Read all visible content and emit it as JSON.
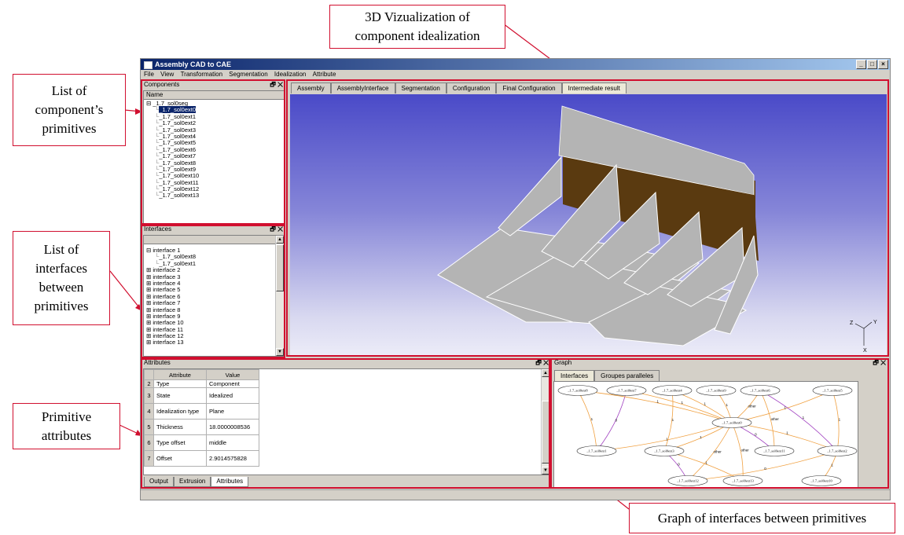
{
  "callouts": {
    "viz": "3D Vizualization of\ncomponent idealization",
    "components": "List of\ncomponent’s\nprimitives",
    "interfaces": "List of\ninterfaces\nbetween\nprimitives",
    "attributes": "Primitive\nattributes",
    "graph": "Graph of interfaces between primitives"
  },
  "window": {
    "title": "Assembly CAD to CAE",
    "min": "_",
    "max": "□",
    "close": "×"
  },
  "menu": [
    "File",
    "View",
    "Transformation",
    "Segmentation",
    "Idealization",
    "Attribute"
  ],
  "components_panel": {
    "title": "Components",
    "column": "Name",
    "root": "_1.7_sol0seg",
    "items": [
      "_1.7_sol0ext0",
      "_1.7_sol0ext1",
      "_1.7_sol0ext2",
      "_1.7_sol0ext3",
      "_1.7_sol0ext4",
      "_1.7_sol0ext5",
      "_1.7_sol0ext6",
      "_1.7_sol0ext7",
      "_1.7_sol0ext8",
      "_1.7_sol0ext9",
      "_1.7_sol0ext10",
      "_1.7_sol0ext11",
      "_1.7_sol0ext12",
      "_1.7_sol0ext13"
    ]
  },
  "interfaces_panel": {
    "title": "Interfaces",
    "expanded": "interface 1",
    "children": [
      "_1.7_sol0ext8",
      "_1.7_sol0ext1"
    ],
    "collapsed": [
      "interface 2",
      "interface 3",
      "interface 4",
      "interface 5",
      "interface 6",
      "interface 7",
      "interface 8",
      "interface 9",
      "interface 10",
      "interface 11",
      "interface 12",
      "interface 13"
    ]
  },
  "view_tabs": [
    "Assembly",
    "AssemblyInterface",
    "Segmentation",
    "Configuration",
    "Final Configuration",
    "Intermediate result"
  ],
  "axes": {
    "y": "Y",
    "z": "Z",
    "x": "X"
  },
  "attributes_panel": {
    "title": "Attributes",
    "col_attribute": "Attribute",
    "col_value": "Value",
    "rows": [
      {
        "n": "2",
        "attr": "Type",
        "val": "Component"
      },
      {
        "n": "3",
        "attr": "State",
        "val": "Idealized"
      },
      {
        "n": "4",
        "attr": "Idealization type",
        "val": "Plane"
      },
      {
        "n": "5",
        "attr": "Thickness",
        "val": "18.0000008536"
      },
      {
        "n": "6",
        "attr": "Type offset",
        "val": "middle"
      },
      {
        "n": "7",
        "attr": "Offset",
        "val": "2.9014575828"
      }
    ],
    "tabs": [
      "Output",
      "Extrusion",
      "Attributes"
    ]
  },
  "graph_panel": {
    "title": "Graph",
    "tabs": [
      "Interfaces",
      "Groupes paralleles"
    ],
    "nodes": {
      "n8": "_1.7_sol0ext8",
      "n7": "_1.7_sol0ext7",
      "n4": "_1.7_sol0ext4",
      "n9": "_1.7_sol0ext9",
      "n6": "_1.7_sol0ext6",
      "n5": "_1.7_sol0ext5",
      "n0": "_1.7_sol0ext0",
      "n1": "_1.7_sol0ext1",
      "n3": "_1.7_sol0ext3",
      "n11": "_1.7_sol0ext11",
      "n2": "_1.7_sol0ext2",
      "n12": "_1.7_sol0ext12",
      "n13": "_1.7_sol0ext13",
      "n10": "_1.7_sol0ext10"
    },
    "edge_labels": {
      "one": "1",
      "zero": "0",
      "other": "other"
    }
  },
  "colors": {
    "callout_red": "#d10f2f",
    "face_gray": "#b4b4b4",
    "face_brown": "#5a3a10",
    "edge_orange": "#f0a040",
    "edge_purple": "#a040c0"
  }
}
